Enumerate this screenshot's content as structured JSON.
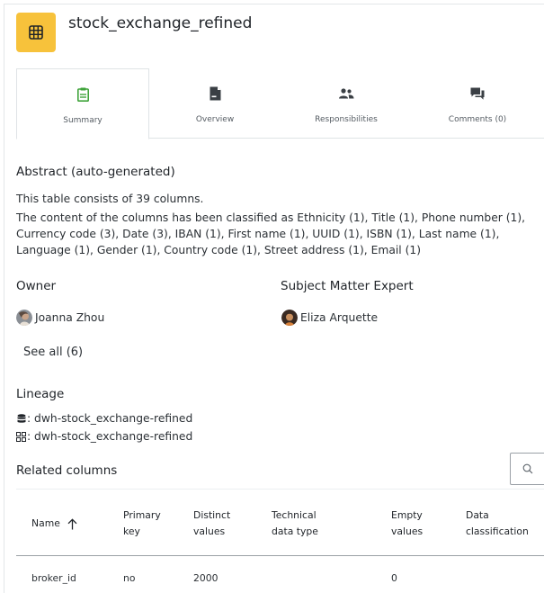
{
  "header": {
    "title": "stock_exchange_refined"
  },
  "tabs": [
    {
      "label": "Summary",
      "icon": "clipboard-icon",
      "active": true
    },
    {
      "label": "Overview",
      "icon": "document-icon",
      "active": false
    },
    {
      "label": "Responsibilities",
      "icon": "people-icon",
      "active": false
    },
    {
      "label": "Comments (0)",
      "icon": "chat-icon",
      "active": false
    }
  ],
  "abstract": {
    "heading": "Abstract (auto-generated)",
    "line1": "This table consists of 39 columns.",
    "line2": "The content of the columns has been classified as Ethnicity (1), Title (1), Phone number (1), Currency code (3), Date (3), IBAN (1), First name (1), UUID (1), ISBN (1), Last name (1), Language (1), Gender (1), Country code (1), Street address (1), Email (1)"
  },
  "owner": {
    "heading": "Owner",
    "name": "Joanna Zhou"
  },
  "sme": {
    "heading": "Subject Matter Expert",
    "name": "Eliza Arquette"
  },
  "see_all": "See all (6)",
  "lineage": {
    "heading": "Lineage",
    "database_entry": ": dwh-stock_exchange-refined",
    "schema_entry": ": dwh-stock_exchange-refined"
  },
  "related_columns": {
    "heading": "Related columns",
    "headers": {
      "name": "Name",
      "primary_key_1": "Primary",
      "primary_key_2": "key",
      "distinct_1": "Distinct",
      "distinct_2": "values",
      "tech_1": "Technical",
      "tech_2": "data type",
      "empty_1": "Empty",
      "empty_2": "values",
      "class_1": "Data",
      "class_2": "classification"
    },
    "rows": [
      {
        "name": "broker_id",
        "primary_key": "no",
        "distinct": "2000",
        "technical": "",
        "empty": "0",
        "classification": ""
      }
    ]
  },
  "colors": {
    "accent_green": "#3fa33a",
    "table_icon_bg": "#f7c23b"
  }
}
